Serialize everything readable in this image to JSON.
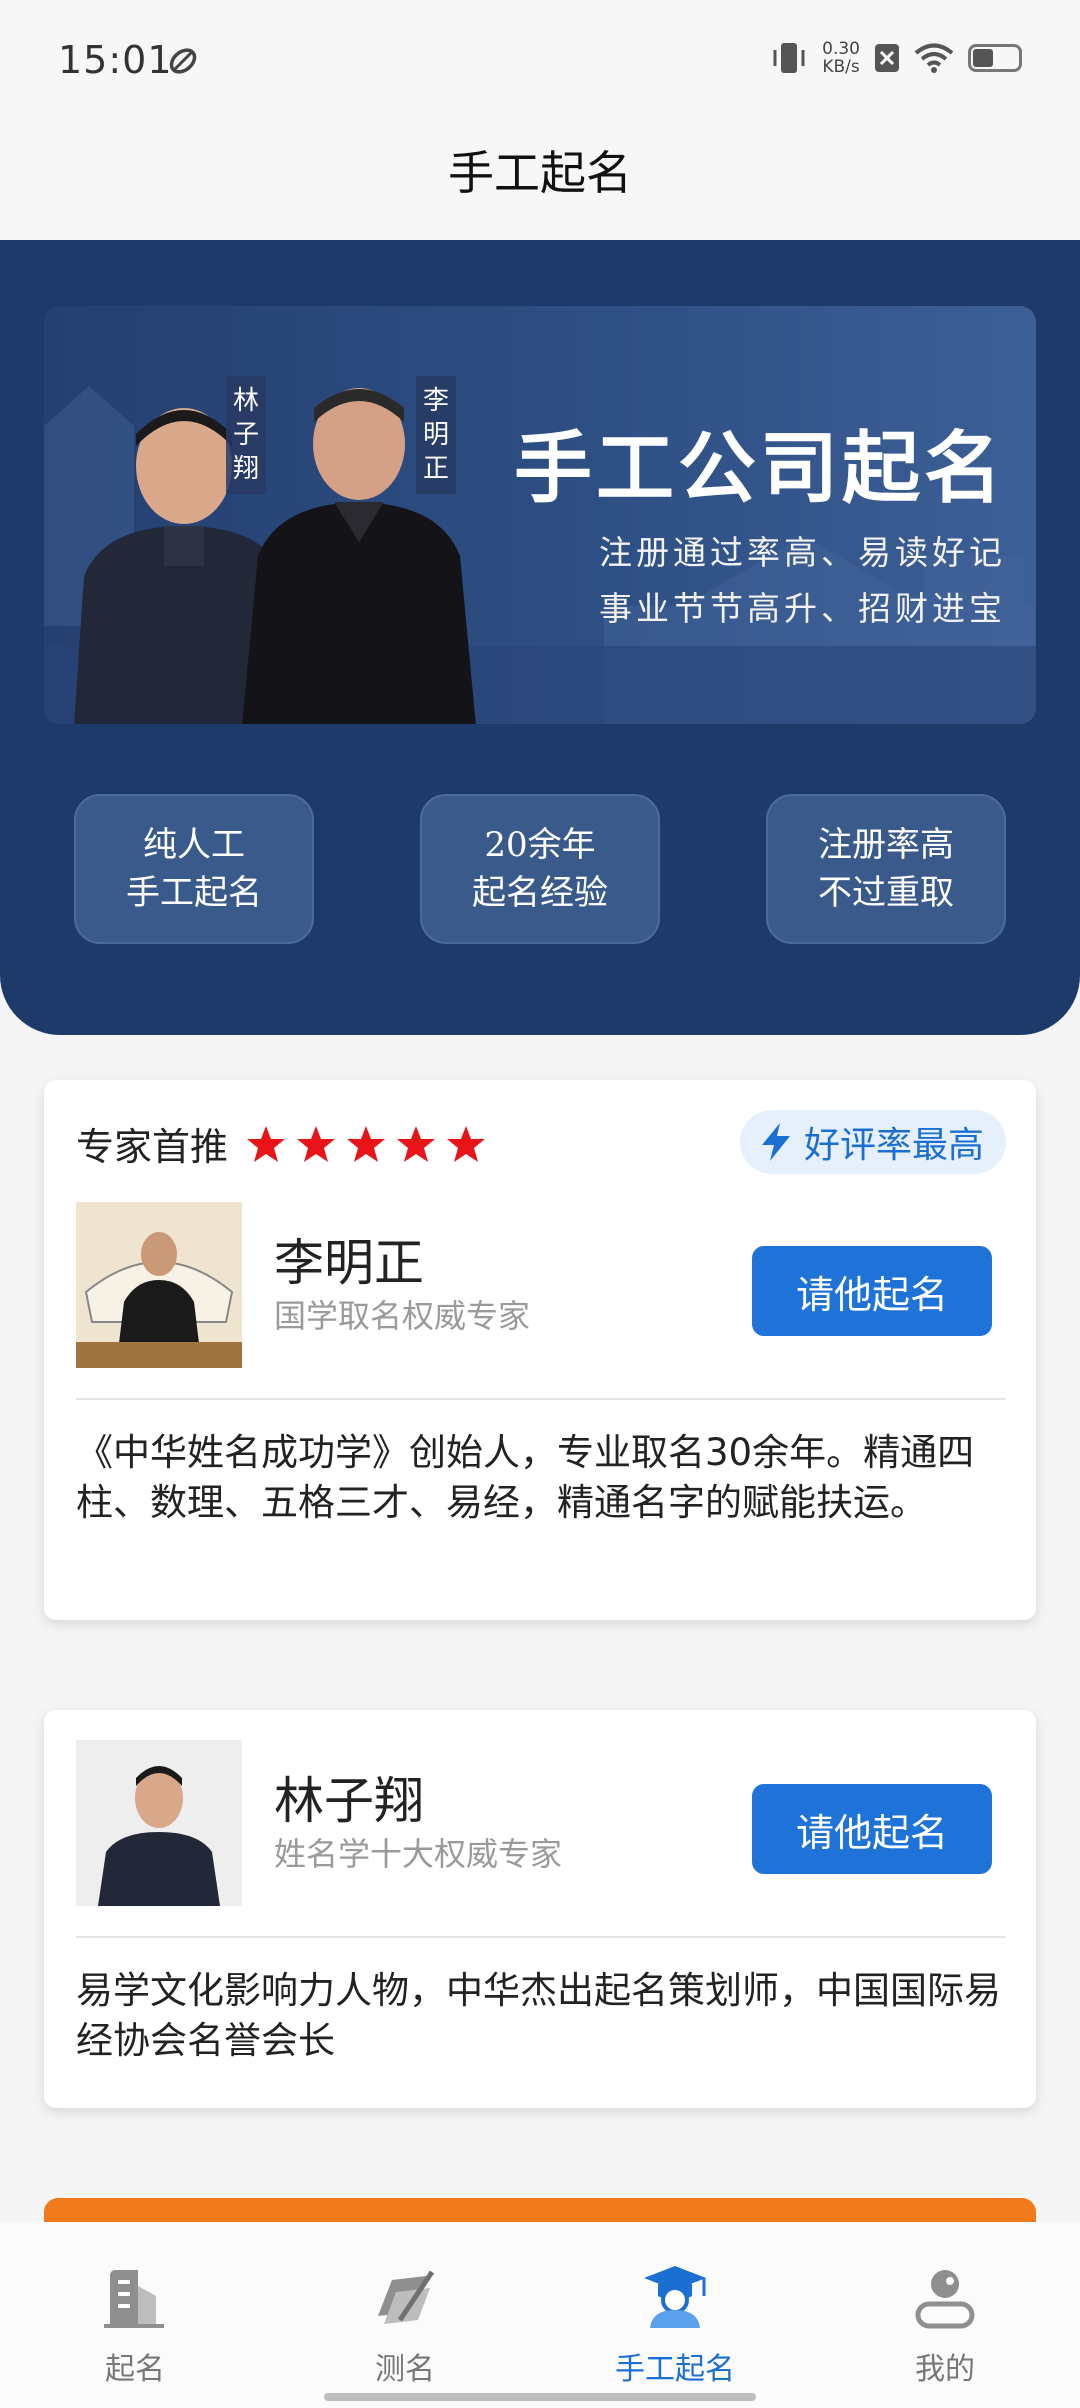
{
  "status": {
    "time": "15:01",
    "net_speed_value": "0.30",
    "net_speed_unit": "KB/s"
  },
  "nav": {
    "title": "手工起名"
  },
  "banner": {
    "headline": "手工公司起名",
    "subline1": "注册通过率高、易读好记",
    "subline2": "事业节节高升、招财进宝",
    "name_tag_left": "林子翔",
    "name_tag_right": "李明正"
  },
  "features": [
    {
      "line1": "纯人工",
      "line2": "手工起名"
    },
    {
      "line1": "20余年",
      "line2": "起名经验"
    },
    {
      "line1": "注册率高",
      "line2": "不过重取"
    }
  ],
  "recommend": {
    "label": "专家首推",
    "rating_stars": 5,
    "badge": "好评率最高"
  },
  "experts": [
    {
      "name": "李明正",
      "title": "国学取名权威专家",
      "button": "请他起名",
      "description": "《中华姓名成功学》创始人，专业取名30余年。精通四柱、数理、五格三才、易经，精通名字的赋能扶运。"
    },
    {
      "name": "林子翔",
      "title": "姓名学十大权威专家",
      "button": "请他起名",
      "description": "易学文化影响力人物，中华杰出起名策划师，中国国际易经协会名誉会长"
    }
  ],
  "tabs": [
    {
      "label": "起名",
      "icon": "building-icon"
    },
    {
      "label": "测名",
      "icon": "book-pen-icon"
    },
    {
      "label": "手工起名",
      "icon": "graduate-icon"
    },
    {
      "label": "我的",
      "icon": "user-icon"
    }
  ],
  "colors": {
    "primary": "#1f73d8",
    "hero_bg": "#1e3a6a",
    "star": "#e8141a",
    "orange": "#f27a1a"
  }
}
